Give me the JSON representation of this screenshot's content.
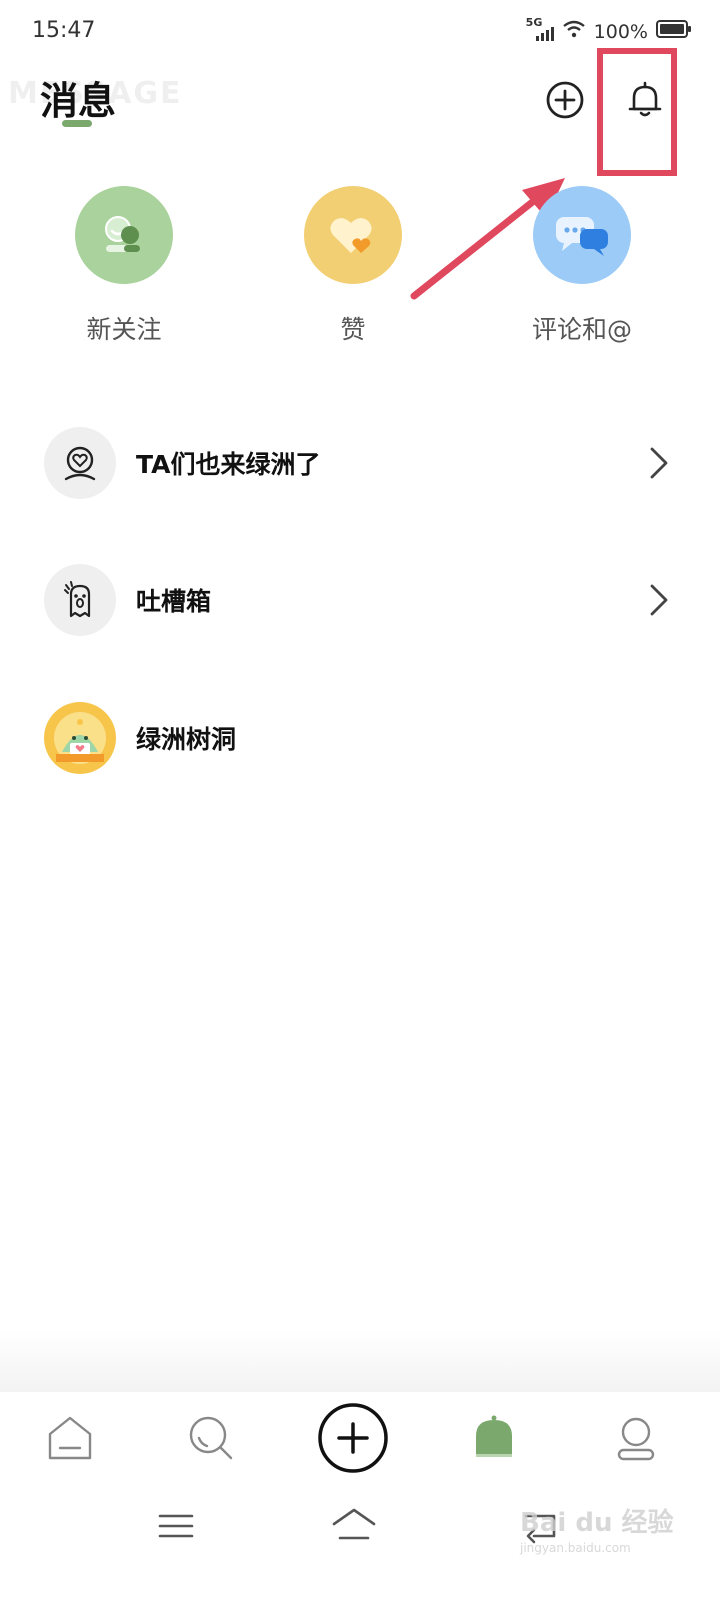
{
  "status_bar": {
    "time": "15:47",
    "network": "5G",
    "battery_percent": "100%",
    "icons": [
      "signal-icon",
      "wifi-icon",
      "battery-icon"
    ]
  },
  "header": {
    "background_word": "MESSAGE",
    "title": "消息",
    "add_icon": "plus-circle-icon",
    "notification_icon": "bell-icon"
  },
  "annotation": {
    "highlight_color": "#e0485e",
    "arrow_color": "#e0485e"
  },
  "quick_actions": [
    {
      "label": "新关注",
      "icon": "new-follower-icon",
      "color": "#a9d29c"
    },
    {
      "label": "赞",
      "icon": "heart-icon",
      "color": "#f3cf73"
    },
    {
      "label": "评论和@",
      "icon": "comment-bubbles-icon",
      "color": "#9ccbf7"
    }
  ],
  "list": [
    {
      "label": "TA们也来绿洲了",
      "icon": "heart-person-icon",
      "has_chevron": true
    },
    {
      "label": "吐槽箱",
      "icon": "ghost-icon",
      "has_chevron": true
    },
    {
      "label": "绿洲树洞",
      "icon": "tree-hole-icon",
      "has_chevron": false
    }
  ],
  "tab_bar": {
    "tabs": [
      "home-icon",
      "discover-icon",
      "create-plus-icon",
      "message-icon",
      "profile-icon"
    ],
    "active_tab": "message-icon",
    "accent_color": "#7aa86d"
  },
  "system_nav": [
    "menu-icon",
    "home-icon",
    "back-icon"
  ],
  "watermark": {
    "brand": "Bai du 经验",
    "url": "jingyan.baidu.com"
  }
}
